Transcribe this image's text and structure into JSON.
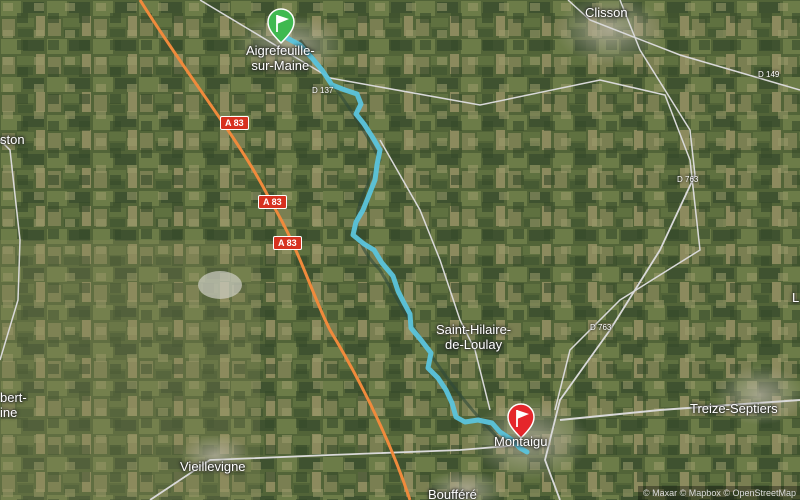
{
  "map": {
    "places": [
      {
        "id": "aigrefeuille",
        "text": "Aigrefeuille-\nsur-Maine"
      },
      {
        "id": "clisson",
        "text": "Clisson"
      },
      {
        "id": "ston",
        "text": "ston"
      },
      {
        "id": "saint-hilaire",
        "text": "Saint-Hilaire-\nde-Loulay"
      },
      {
        "id": "montaigu",
        "text": "Montaigu"
      },
      {
        "id": "treize-septiers",
        "text": "Treize-Septiers"
      },
      {
        "id": "vieillevigne",
        "text": "Vieillevigne"
      },
      {
        "id": "boufferé",
        "text": "Boufféré"
      },
      {
        "id": "bert",
        "text": "bert-\nine"
      },
      {
        "id": "edge-l",
        "text": "L"
      }
    ],
    "road_shields": [
      {
        "id": "a83-1",
        "text": "A 83"
      },
      {
        "id": "a83-2",
        "text": "A 83"
      },
      {
        "id": "a83-3",
        "text": "A 83"
      }
    ],
    "road_refs": [
      {
        "id": "d137",
        "text": "D 137"
      },
      {
        "id": "d763a",
        "text": "D 763"
      },
      {
        "id": "d763b",
        "text": "D 763"
      },
      {
        "id": "d149",
        "text": "D 149"
      }
    ],
    "markers": {
      "start": {
        "kind": "start",
        "icon": "flag-icon",
        "color": "#3fb950"
      },
      "end": {
        "kind": "end",
        "icon": "flag-icon",
        "color": "#e5262b"
      }
    },
    "route_color": "#5bc4dc",
    "attribution": "© Maxar © Mapbox © OpenStreetMap"
  }
}
